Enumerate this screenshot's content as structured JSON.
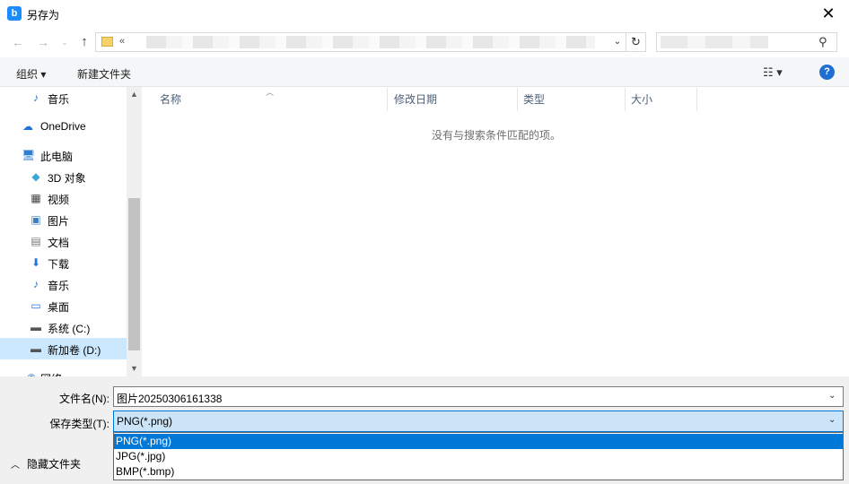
{
  "window": {
    "title": "另存为",
    "app_icon": "b",
    "close": "✕"
  },
  "address": {
    "prefix": "«"
  },
  "toolbar": {
    "organize": "组织 ▾",
    "new_folder": "新建文件夹",
    "view": "☷ ▾",
    "help": "?"
  },
  "nav": {
    "items": [
      {
        "label": "音乐",
        "icon": "music-icon",
        "glyph": "♪",
        "color": "#1e74d9"
      },
      {
        "label": "OneDrive",
        "icon": "cloud-icon",
        "glyph": "☁",
        "color": "#1e74d9"
      },
      {
        "label": "此电脑",
        "icon": "computer-icon",
        "glyph": "🖥",
        "color": "#2d7dd2"
      },
      {
        "label": "3D 对象",
        "icon": "cube-icon",
        "glyph": "◆",
        "color": "#39a8d8"
      },
      {
        "label": "视频",
        "icon": "film-icon",
        "glyph": "▦",
        "color": "#444"
      },
      {
        "label": "图片",
        "icon": "picture-icon",
        "glyph": "▣",
        "color": "#3c7fc4"
      },
      {
        "label": "文档",
        "icon": "document-icon",
        "glyph": "▤",
        "color": "#777"
      },
      {
        "label": "下载",
        "icon": "download-icon",
        "glyph": "⬇",
        "color": "#1e74d9"
      },
      {
        "label": "音乐",
        "icon": "music-icon",
        "glyph": "♪",
        "color": "#1e74d9"
      },
      {
        "label": "桌面",
        "icon": "desktop-icon",
        "glyph": "▭",
        "color": "#1e74d9"
      },
      {
        "label": "系统 (C:)",
        "icon": "drive-icon",
        "glyph": "▬",
        "color": "#555"
      },
      {
        "label": "新加卷 (D:)",
        "icon": "drive-icon",
        "glyph": "▬",
        "color": "#555"
      },
      {
        "label": "网络",
        "icon": "network-icon",
        "glyph": "◉",
        "color": "#3c7fc4"
      }
    ]
  },
  "list": {
    "columns": [
      "名称",
      "修改日期",
      "类型",
      "大小"
    ],
    "empty_message": "没有与搜索条件匹配的项。"
  },
  "bottom": {
    "filename_label": "文件名(N):",
    "filename_value": "图片20250306161338",
    "filetype_label": "保存类型(T):",
    "filetype_value": "PNG(*.png)",
    "filetype_options": [
      "PNG(*.png)",
      "JPG(*.jpg)",
      "BMP(*.bmp)"
    ],
    "hide_folders": "隐藏文件夹"
  }
}
